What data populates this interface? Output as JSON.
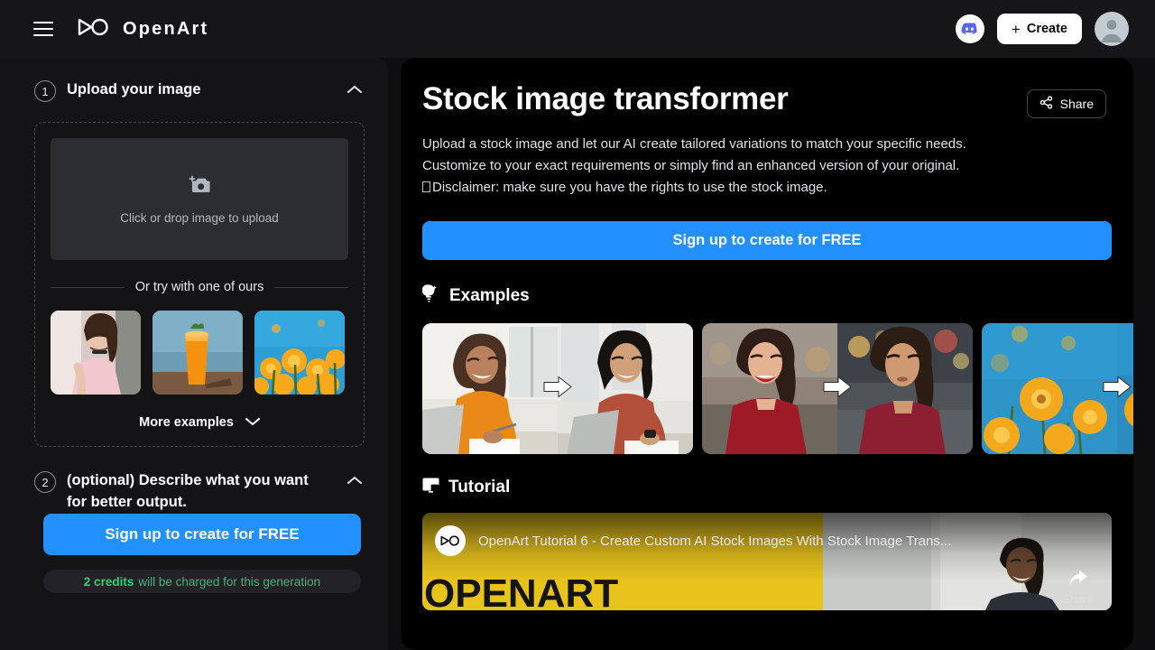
{
  "topbar": {
    "menu_icon": "hamburger-icon",
    "logo_icon": "openart-logo-icon",
    "brand": "OpenArt",
    "discord_icon": "discord-icon",
    "create_label": "Create",
    "create_plus": "+",
    "avatar_icon": "user-avatar-icon"
  },
  "sidebar": {
    "step1": {
      "number": "1",
      "title": "Upload your image",
      "collapse_icon": "chevron-up-icon",
      "dropzone": {
        "icon": "camera-plus-icon",
        "label": "Click or drop image to upload"
      },
      "or_text": "Or try with one of ours",
      "thumbnails": [
        {
          "name": "portrait-woman-pink-dress"
        },
        {
          "name": "orange-cocktail-drink"
        },
        {
          "name": "orange-poppy-flowers"
        }
      ],
      "more_label": "More examples",
      "more_icon": "chevron-down-icon"
    },
    "step2": {
      "number": "2",
      "title": "(optional) Describe what you want for better output.",
      "collapse_icon": "chevron-up-icon",
      "cta_label": "Sign up to create for FREE",
      "credits_amount": "2 credits",
      "credits_rest": "will be charged for this generation"
    }
  },
  "main": {
    "title": "Stock image transformer",
    "share_label": "Share",
    "share_icon": "share-nodes-icon",
    "description_line1": "Upload a stock image and let our AI create tailored variations to match your specific needs. Customize to your exact requirements or simply find an enhanced version of your original.",
    "description_line2": "Disclaimer: make sure you have the rights to use the stock image.",
    "signup_label": "Sign up to create for FREE",
    "examples": {
      "icon": "lightbulb-sparkle-icon",
      "title": "Examples",
      "cards": [
        {
          "name": "example-office-workers",
          "arrow_icon": "arrow-right-icon"
        },
        {
          "name": "example-woman-red-sweater",
          "arrow_icon": "arrow-right-icon"
        },
        {
          "name": "example-yellow-flowers",
          "arrow_icon": "arrow-right-icon"
        }
      ]
    },
    "tutorial": {
      "icon": "video-screen-icon",
      "title": "Tutorial",
      "video_title": "OpenArt Tutorial 6 - Create Custom AI Stock Images With Stock Image Trans...",
      "video_channel_icon": "openart-logo-icon",
      "share_label": "Share",
      "share_icon": "share-arrow-icon",
      "thumbnail_word": "OPENART"
    }
  },
  "colors": {
    "accent_blue": "#2291ff",
    "credits_green": "#31d07a",
    "page_bg": "#0e0e10",
    "panel_bg": "#000000",
    "sidebar_bg": "#141417"
  }
}
